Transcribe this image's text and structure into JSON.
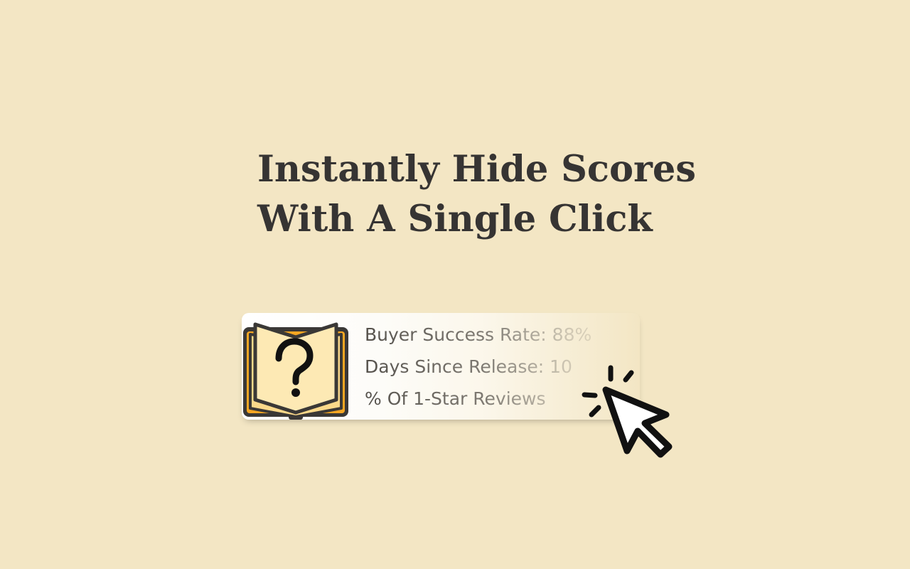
{
  "headline": {
    "line1": "Instantly Hide Scores",
    "line2": "With A Single Click"
  },
  "card": {
    "icon": "book-question-icon",
    "stats": [
      {
        "label": "Buyer Success Rate: 88%"
      },
      {
        "label": "Days Since Release: 10"
      },
      {
        "label": "% Of 1-Star Reviews"
      }
    ]
  },
  "cursor": {
    "icon": "click-cursor-icon"
  },
  "colors": {
    "background": "#f3e6c4",
    "text": "#363433",
    "book_page": "#fde9b4",
    "book_cover": "#f5a623",
    "outline": "#333333"
  }
}
